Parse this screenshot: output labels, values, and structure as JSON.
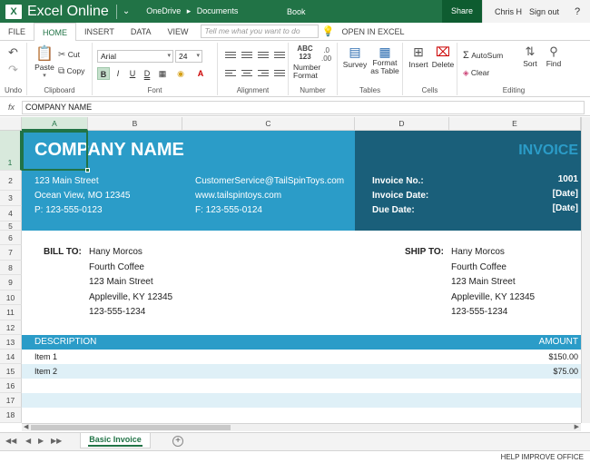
{
  "titlebar": {
    "logo": "X",
    "app_name": "Excel Online",
    "menu_icon": "chevron-down-icon",
    "breadcrumb": [
      "OneDrive",
      "▸",
      "Documents"
    ],
    "book": "Book",
    "share": "Share",
    "user": "Chris H",
    "sign_out": "Sign out",
    "help": "?"
  },
  "tabs": {
    "items": [
      "FILE",
      "HOME",
      "INSERT",
      "DATA",
      "VIEW"
    ],
    "active": "HOME",
    "tell_me_placeholder": "Tell me what you want to do",
    "open_in_excel": "OPEN IN EXCEL"
  },
  "ribbon": {
    "undo": {
      "label": "Undo"
    },
    "clipboard": {
      "label": "Clipboard",
      "paste": "Paste",
      "cut": "Cut",
      "copy": "Copy"
    },
    "font": {
      "label": "Font",
      "name": "Arial",
      "size": "24",
      "bold": "B",
      "italic": "I",
      "underline": "U",
      "double_underline": "D"
    },
    "alignment": {
      "label": "Alignment"
    },
    "number": {
      "label": "Number",
      "format": "Number Format",
      "abc": "ABC 123"
    },
    "tables": {
      "label": "Tables",
      "survey": "Survey",
      "format_as_table": "Format as Table"
    },
    "cells": {
      "label": "Cells",
      "insert": "Insert",
      "delete": "Delete"
    },
    "editing": {
      "label": "Editing",
      "autosum": "AutoSum",
      "clear": "Clear",
      "sort": "Sort",
      "find": "Find"
    }
  },
  "formula_bar": {
    "fx": "fx",
    "value": "COMPANY NAME"
  },
  "columns": [
    "A",
    "B",
    "C",
    "D",
    "E"
  ],
  "active_column": "A",
  "rows": [
    "1",
    "2",
    "3",
    "4",
    "5",
    "6",
    "7",
    "8",
    "9",
    "10",
    "11",
    "12",
    "13",
    "14",
    "15",
    "16",
    "17",
    "18"
  ],
  "active_row": "1",
  "invoice": {
    "company_name": "COMPANY NAME",
    "title": "INVOICE",
    "address": [
      "123 Main Street",
      "Ocean View, MO 12345",
      "P: 123-555-0123"
    ],
    "contact": [
      "CustomerService@TailSpinToys.com",
      "www.tailspintoys.com",
      "F: 123-555-0124"
    ],
    "meta_labels": [
      "Invoice No.:",
      "Invoice Date:",
      "Due Date:"
    ],
    "meta_values": [
      "1001",
      "[Date]",
      "[Date]"
    ],
    "bill_to_label": "BILL TO:",
    "bill_to": [
      "Hany Morcos",
      "Fourth Coffee",
      "123 Main Street",
      "Appleville, KY 12345",
      "123-555-1234"
    ],
    "ship_to_label": "SHIP TO:",
    "ship_to": [
      "Hany Morcos",
      "Fourth Coffee",
      "123 Main Street",
      "Appleville, KY 12345",
      "123-555-1234"
    ],
    "table_header": {
      "description": "DESCRIPTION",
      "amount": "AMOUNT"
    },
    "items": [
      {
        "description": "Item 1",
        "amount": "$150.00"
      },
      {
        "description": "Item 2",
        "amount": "$75.00"
      }
    ]
  },
  "sheet_tabs": {
    "active": "Basic Invoice",
    "add_icon": "plus-icon"
  },
  "status": {
    "help_improve": "HELP IMPROVE OFFICE"
  },
  "colors": {
    "excel_green": "#217346",
    "header_blue": "#2b9cc8",
    "header_dark": "#1a5f7a",
    "row_stripe": "#dff0f7"
  }
}
